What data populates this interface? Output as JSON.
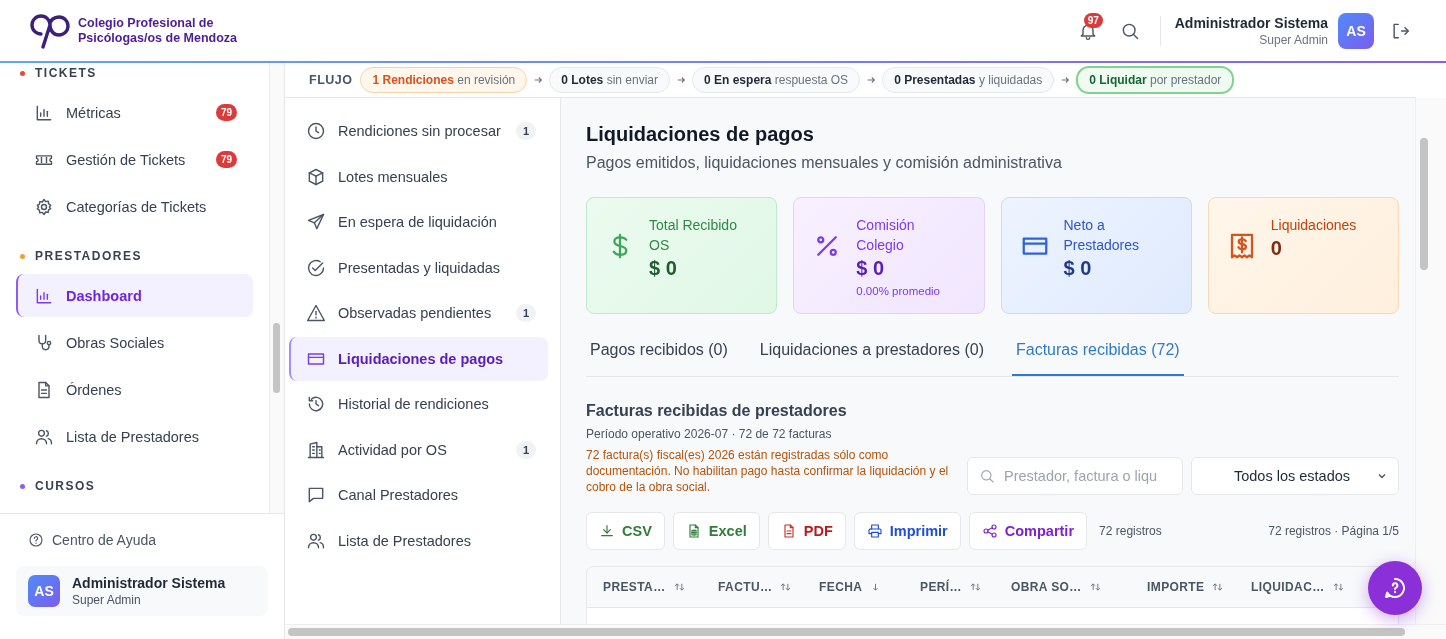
{
  "brand": {
    "line1": "Colegio Profesional de",
    "line2": "Psicólogas/os de Mendoza"
  },
  "header": {
    "notifications": "97",
    "user": {
      "name": "Administrador Sistema",
      "role": "Super Admin",
      "initials": "AS"
    }
  },
  "sidebar": {
    "sections": [
      {
        "title": "TICKETS",
        "color": "#e0483e",
        "items": [
          {
            "label": "Métricas",
            "badge": "79",
            "selected": false
          },
          {
            "label": "Gestión de Tickets",
            "badge": "79",
            "selected": false
          },
          {
            "label": "Categorías de Tickets",
            "selected": false
          }
        ]
      },
      {
        "title": "PRESTADORES",
        "color": "#f0a030",
        "items": [
          {
            "label": "Dashboard",
            "selected": true
          },
          {
            "label": "Obras Sociales",
            "selected": false
          },
          {
            "label": "Órdenes",
            "selected": false
          },
          {
            "label": "Lista de Prestadores",
            "selected": false
          }
        ]
      },
      {
        "title": "CURSOS",
        "color": "#8b5cf6"
      }
    ],
    "help": "Centro de Ayuda",
    "user": {
      "name": "Administrador Sistema",
      "role": "Super Admin",
      "initials": "AS"
    }
  },
  "flow": {
    "label": "FLUJO",
    "steps": [
      {
        "count": "1",
        "label": "Rendiciones",
        "detail": "en revisión",
        "kind": "warning"
      },
      {
        "count": "0",
        "label": "Lotes",
        "detail": "sin enviar",
        "kind": "neutral"
      },
      {
        "count": "0",
        "label": "En espera",
        "detail": "respuesta OS",
        "kind": "neutral"
      },
      {
        "count": "0",
        "label": "Presentadas",
        "detail": "y liquidadas",
        "kind": "neutral"
      },
      {
        "count": "0",
        "label": "Liquidar",
        "detail": "por prestador",
        "kind": "success"
      }
    ]
  },
  "subnav": [
    {
      "label": "Rendiciones sin procesar",
      "badge": "1",
      "selected": false
    },
    {
      "label": "Lotes mensuales",
      "selected": false
    },
    {
      "label": "En espera de liquidación",
      "selected": false
    },
    {
      "label": "Presentadas y liquidadas",
      "selected": false
    },
    {
      "label": "Observadas pendientes",
      "badge": "1",
      "selected": false
    },
    {
      "label": "Liquidaciones de pagos",
      "selected": true
    },
    {
      "label": "Historial de rendiciones",
      "selected": false
    },
    {
      "label": "Actividad por OS",
      "badge": "1",
      "selected": false
    },
    {
      "label": "Canal Prestadores",
      "selected": false
    },
    {
      "label": "Lista de Prestadores",
      "selected": false
    }
  ],
  "page": {
    "title": "Liquidaciones de pagos",
    "subtitle": "Pagos emitidos, liquidaciones mensuales y comisión administrativa"
  },
  "stats": [
    {
      "kind": "green",
      "label": "Total Recibido OS",
      "value": "$ 0"
    },
    {
      "kind": "purple",
      "label": "Comisión Colegio",
      "value": "$ 0",
      "note": "0.00% promedio"
    },
    {
      "kind": "blue",
      "label": "Neto a Prestadores",
      "value": "$ 0"
    },
    {
      "kind": "orange",
      "label": "Liquidaciones",
      "value": "0"
    }
  ],
  "tabs": [
    {
      "label": "Pagos recibidos (0)",
      "selected": false
    },
    {
      "label": "Liquidaciones a prestadores (0)",
      "selected": false
    },
    {
      "label": "Facturas recibidas (72)",
      "selected": true
    }
  ],
  "invoices": {
    "title": "Facturas recibidas de prestadores",
    "period": "Período operativo 2026-07 · 72 de 72 facturas",
    "warning": "72 factura(s) fiscal(es) 2026 están registradas sólo como documentación. No habilitan pago hasta confirmar la liquidación y el cobro de la obra social.",
    "search": {
      "placeholder": "Prestador, factura o liqu"
    },
    "filter": {
      "value": "Todos los estados"
    },
    "exports": [
      {
        "label": "CSV",
        "kind": "csv"
      },
      {
        "label": "Excel",
        "kind": "excel"
      },
      {
        "label": "PDF",
        "kind": "pdf"
      },
      {
        "label": "Imprimir",
        "kind": "print"
      },
      {
        "label": "Compartir",
        "kind": "share"
      }
    ],
    "count": "72 registros",
    "pagination": "72 registros · Página 1/5",
    "columns": [
      {
        "label": "PRESTA…",
        "sorted": false
      },
      {
        "label": "FACTU…",
        "sorted": false
      },
      {
        "label": "FECHA",
        "sorted": true
      },
      {
        "label": "PERÍ…",
        "sorted": false
      },
      {
        "label": "OBRA SO…",
        "sorted": false
      },
      {
        "label": "IMPORTE",
        "sorted": false
      },
      {
        "label": "LIQUIDAC…",
        "sorted": false
      }
    ]
  }
}
